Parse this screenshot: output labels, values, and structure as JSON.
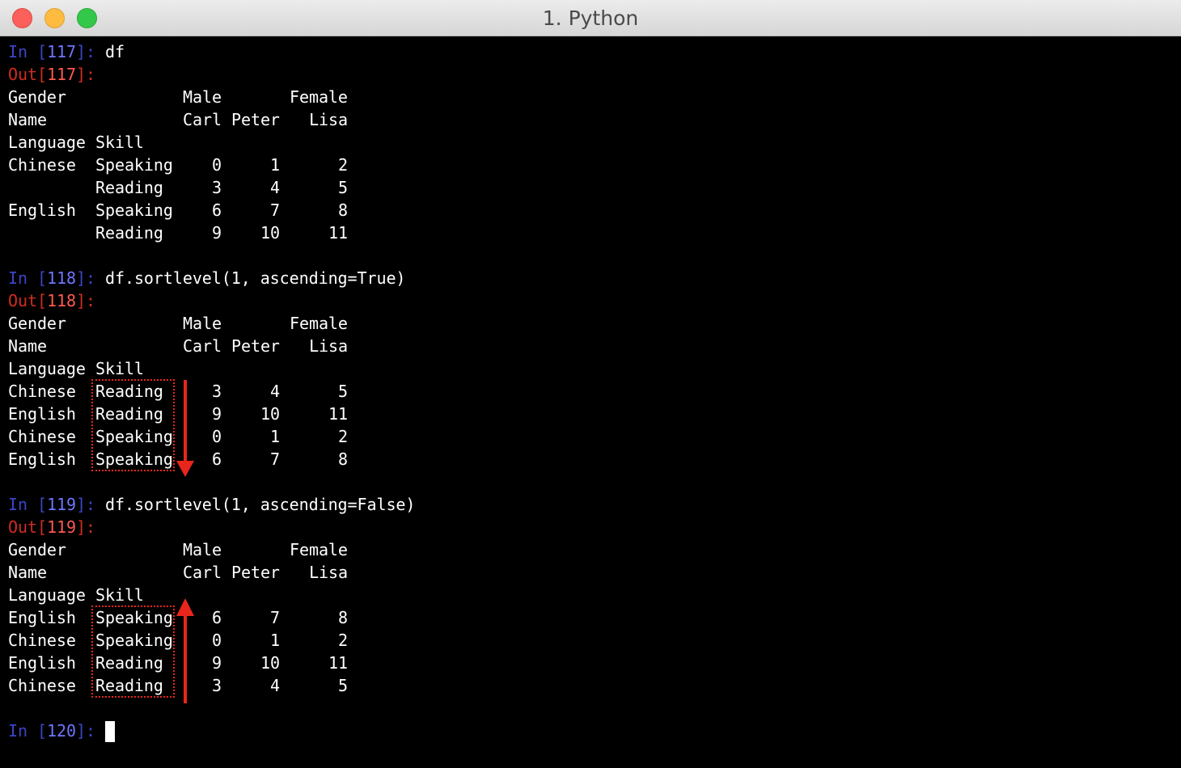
{
  "window": {
    "title": "1. Python"
  },
  "colors": {
    "prompt_in": "#3b45c6",
    "prompt_in_number": "#6f75ff",
    "prompt_out": "#d22c20",
    "prompt_out_number": "#ff5a4e",
    "annotation": "#e8261c"
  },
  "cells": [
    {
      "in_number": "117",
      "command": "df",
      "out_number": "117",
      "table": {
        "gender_row": [
          "Gender",
          "Male",
          "Female"
        ],
        "name_row": [
          "Name",
          "Carl",
          "Peter",
          "Lisa"
        ],
        "index_names": [
          "Language",
          "Skill"
        ],
        "rows": [
          {
            "language": "Chinese",
            "skill": "Speaking",
            "values": [
              "0",
              "1",
              "2"
            ]
          },
          {
            "language": "",
            "skill": "Reading",
            "values": [
              "3",
              "4",
              "5"
            ]
          },
          {
            "language": "English",
            "skill": "Speaking",
            "values": [
              "6",
              "7",
              "8"
            ]
          },
          {
            "language": "",
            "skill": "Reading",
            "values": [
              "9",
              "10",
              "11"
            ]
          }
        ]
      }
    },
    {
      "in_number": "118",
      "command": "df.sortlevel(1, ascending=True)",
      "out_number": "118",
      "table": {
        "gender_row": [
          "Gender",
          "Male",
          "Female"
        ],
        "name_row": [
          "Name",
          "Carl",
          "Peter",
          "Lisa"
        ],
        "index_names": [
          "Language",
          "Skill"
        ],
        "rows": [
          {
            "language": "Chinese",
            "skill": "Reading",
            "values": [
              "3",
              "4",
              "5"
            ]
          },
          {
            "language": "English",
            "skill": "Reading",
            "values": [
              "9",
              "10",
              "11"
            ]
          },
          {
            "language": "Chinese",
            "skill": "Speaking",
            "values": [
              "0",
              "1",
              "2"
            ]
          },
          {
            "language": "English",
            "skill": "Speaking",
            "values": [
              "6",
              "7",
              "8"
            ]
          }
        ]
      },
      "annotation_arrow": "down"
    },
    {
      "in_number": "119",
      "command": "df.sortlevel(1, ascending=False)",
      "out_number": "119",
      "table": {
        "gender_row": [
          "Gender",
          "Male",
          "Female"
        ],
        "name_row": [
          "Name",
          "Carl",
          "Peter",
          "Lisa"
        ],
        "index_names": [
          "Language",
          "Skill"
        ],
        "rows": [
          {
            "language": "English",
            "skill": "Speaking",
            "values": [
              "6",
              "7",
              "8"
            ]
          },
          {
            "language": "Chinese",
            "skill": "Speaking",
            "values": [
              "0",
              "1",
              "2"
            ]
          },
          {
            "language": "English",
            "skill": "Reading",
            "values": [
              "9",
              "10",
              "11"
            ]
          },
          {
            "language": "Chinese",
            "skill": "Reading",
            "values": [
              "3",
              "4",
              "5"
            ]
          }
        ]
      },
      "annotation_arrow": "up"
    }
  ],
  "prompt_labels": {
    "in": "In",
    "out": "Out",
    "open": "[",
    "close": "]",
    "colon": ":"
  },
  "final_prompt": {
    "in_number": "120"
  }
}
